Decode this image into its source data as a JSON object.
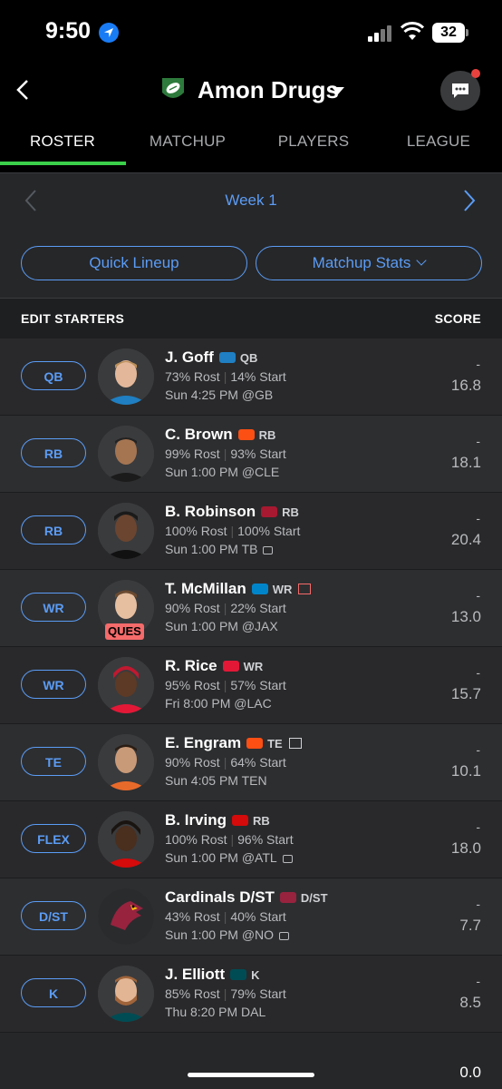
{
  "status": {
    "time": "9:50",
    "battery": "32"
  },
  "header": {
    "team_name": "Amon Drugs"
  },
  "tabs": [
    {
      "label": "ROSTER"
    },
    {
      "label": "MATCHUP"
    },
    {
      "label": "PLAYERS"
    },
    {
      "label": "LEAGUE"
    }
  ],
  "week": {
    "label": "Week 1"
  },
  "buttons": {
    "quick_lineup": "Quick Lineup",
    "matchup_stats": "Matchup Stats"
  },
  "section": {
    "left": "EDIT STARTERS",
    "right": "SCORE"
  },
  "players": [
    {
      "slot": "QB",
      "name": "J. Goff",
      "pos": "QB",
      "rost": "73% Rost",
      "start": "14% Start",
      "game": "Sun 4:25 PM @GB",
      "dash": "-",
      "score": "16.8",
      "team_color": "#1f7fc2"
    },
    {
      "slot": "RB",
      "name": "C. Brown",
      "pos": "RB",
      "rost": "99% Rost",
      "start": "93% Start",
      "game": "Sun 1:00 PM @CLE",
      "dash": "-",
      "score": "18.1",
      "team_color": "#fb4f14"
    },
    {
      "slot": "RB",
      "name": "B. Robinson",
      "pos": "RB",
      "rost": "100% Rost",
      "start": "100% Start",
      "game": "Sun 1:00 PM TB",
      "dash": "-",
      "score": "20.4",
      "team_color": "#a71930"
    },
    {
      "slot": "WR",
      "name": "T. McMillan",
      "pos": "WR",
      "rost": "90% Rost",
      "start": "22% Start",
      "game": "Sun 1:00 PM @JAX",
      "dash": "-",
      "score": "13.0",
      "team_color": "#0085ca",
      "badge": "QUES"
    },
    {
      "slot": "WR",
      "name": "R. Rice",
      "pos": "WR",
      "rost": "95% Rost",
      "start": "57% Start",
      "game": "Fri 8:00 PM @LAC",
      "dash": "-",
      "score": "15.7",
      "team_color": "#e31837"
    },
    {
      "slot": "TE",
      "name": "E. Engram",
      "pos": "TE",
      "rost": "90% Rost",
      "start": "64% Start",
      "game": "Sun 4:05 PM TEN",
      "dash": "-",
      "score": "10.1",
      "team_color": "#fb4f14"
    },
    {
      "slot": "FLEX",
      "name": "B. Irving",
      "pos": "RB",
      "rost": "100% Rost",
      "start": "96% Start",
      "game": "Sun 1:00 PM @ATL",
      "dash": "-",
      "score": "18.0",
      "team_color": "#d50a0a"
    },
    {
      "slot": "D/ST",
      "name": "Cardinals D/ST",
      "pos": "D/ST",
      "rost": "43% Rost",
      "start": "40% Start",
      "game": "Sun 1:00 PM @NO",
      "dash": "-",
      "score": "7.7",
      "team_color": "#97233f"
    },
    {
      "slot": "K",
      "name": "J. Elliott",
      "pos": "K",
      "rost": "85% Rost",
      "start": "79% Start",
      "game": "Thu 8:20 PM DAL",
      "dash": "-",
      "score": "8.5",
      "team_color": "#004c54"
    }
  ],
  "footer": {
    "total": "0.0"
  },
  "colors": {
    "accent": "#5b9cf5",
    "tab_indicator": "#3bd04a",
    "ques": "#f56a6a"
  }
}
